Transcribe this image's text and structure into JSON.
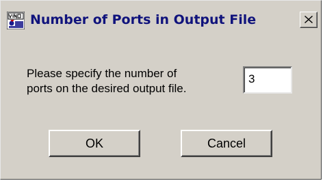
{
  "window": {
    "title": "Number of Ports in Output File",
    "app_icon": "vino-app-icon",
    "close_icon": "close-icon"
  },
  "prompt": {
    "line1": "Please specify the number of",
    "line2": "ports on the desired output file."
  },
  "ports_field": {
    "value": "3"
  },
  "buttons": {
    "ok_label": "OK",
    "cancel_label": "Cancel"
  },
  "colors": {
    "dialog_face": "#d4d0c8",
    "title_text": "#10137c"
  }
}
